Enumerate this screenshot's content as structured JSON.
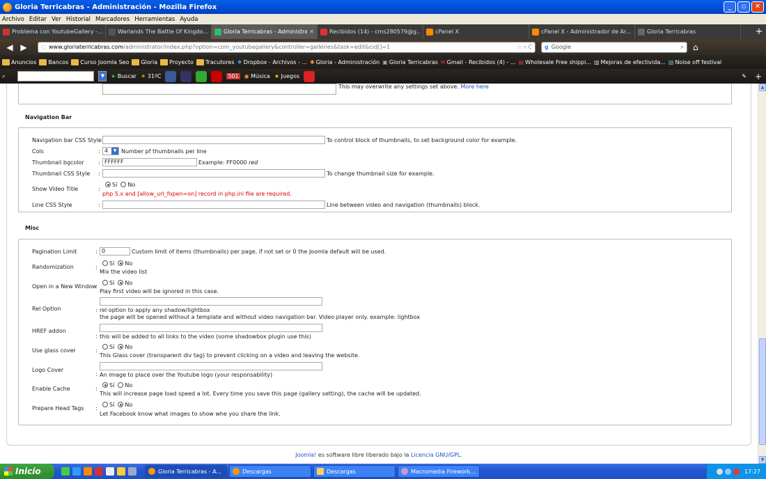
{
  "window": {
    "title": "Gloria Terricabras - Administración - Mozilla Firefox"
  },
  "menu": [
    "Archivo",
    "Editar",
    "Ver",
    "Historial",
    "Marcadores",
    "Herramientas",
    "Ayuda"
  ],
  "tabs": [
    {
      "label": "Problema con YoutubeGallery -...",
      "color": "#c33"
    },
    {
      "label": "Warlands The Battle Of Kingdo...",
      "color": "#555"
    },
    {
      "label": "Gloria Terricabras - Administrac...",
      "color": "#3b6",
      "active": true
    },
    {
      "label": "Recibidos (14) - cms280579@g...",
      "color": "#d33"
    },
    {
      "label": "cPanel X",
      "color": "#f80"
    },
    {
      "label": "cPanel X - Administrador de Ar...",
      "color": "#f80"
    },
    {
      "label": "Gloria Terricabras",
      "color": "#666"
    }
  ],
  "nav": {
    "url_domain": "www.gloriaterricabras.com",
    "url_path": "/administrator/index.php?option=com_youtubegallery&controller=galleries&task=edit&cid[]=1",
    "search_placeholder": "Google"
  },
  "bookmarks": [
    {
      "label": "Anuncios"
    },
    {
      "label": "Bancos"
    },
    {
      "label": "Curso Joomla Seo"
    },
    {
      "label": "Gloria"
    },
    {
      "label": "Proyecto"
    },
    {
      "label": "Tracutores"
    },
    {
      "label": "Dropbox - Archivos - ..."
    },
    {
      "label": "Gloria - Administración"
    },
    {
      "label": "Gloria Terricabras"
    },
    {
      "label": "Gmail - Recibidos (4) - ..."
    },
    {
      "label": "Wholesale Free shippi..."
    },
    {
      "label": "Mejoras de efectivida..."
    },
    {
      "label": "Noise off festival"
    }
  ],
  "toolbar2": {
    "buscar": "Buscar",
    "temp": "31ºC",
    "count": "501",
    "musica": "Música",
    "juegos": "Juegos"
  },
  "top_partial": {
    "note": "This may overwrite any settings set above.",
    "more": "More here"
  },
  "navigation_bar": {
    "legend": "Navigation Bar",
    "css_style": {
      "label": "Navigation bar CSS Style",
      "value": "",
      "hint": "To control block of thumbnails, to set background color for example."
    },
    "cols": {
      "label": "Cols",
      "value": "4",
      "hint": "Number pf thumbnails per line"
    },
    "bgcolor": {
      "label": "Thumbnail bgcolor",
      "value": "FFFFFF",
      "hint": "Example: FF0000",
      "hint_em": "red"
    },
    "thumb_css": {
      "label": "Thumbnail CSS Style",
      "value": "",
      "hint": "To change thumbnail size for example."
    },
    "show_title": {
      "label": "Show Video Title",
      "yes": "Sí",
      "no": "No",
      "selected": "yes",
      "warning": "php 5.x and [allow_url_fopen=on] record in php.ini file are required."
    },
    "line_css": {
      "label": "Line CSS Style",
      "value": "",
      "hint": "Line between video and navigation (thumbnails) block."
    }
  },
  "misc": {
    "legend": "Misc",
    "pagination": {
      "label": "Pagination Limit",
      "value": "0",
      "hint": "Custom limit of items (thumbnails) per page, if not set or 0 the Joomla default will be used."
    },
    "random": {
      "label": "Randomization",
      "yes": "Sí",
      "no": "No",
      "selected": "no",
      "hint": "Mix the video list"
    },
    "new_window": {
      "label": "Open in a New Window",
      "yes": "Sí",
      "no": "No",
      "selected": "no",
      "hint": "Play first video will be ignored in this case."
    },
    "rel": {
      "label": "Rel Option",
      "value": "",
      "hint1": "rel option to apply any shadow/lightbox",
      "hint2": "the page will be opened without a template and without video navigation bar. Video player only. example: lightbox"
    },
    "href": {
      "label": "HREF addon",
      "value": "",
      "hint": "this will be added to all links to the video (some shadowbox plugin use this)"
    },
    "glass": {
      "label": "Use glass cover",
      "yes": "Sí",
      "no": "No",
      "selected": "no",
      "hint": "This Glass cover (transparent div tag) to prevent clicking on a video and leaving the website."
    },
    "logo": {
      "label": "Logo Cover",
      "value": "",
      "hint": "An image to place over the Youtube logo (your responsability)"
    },
    "cache": {
      "label": "Enable Cache",
      "yes": "Sí",
      "no": "No",
      "selected": "yes",
      "hint": "This will increase page load speed a lot. Every time you save this page (gallery setting), the cache will be updated."
    },
    "head": {
      "label": "Prepare Head Tags",
      "yes": "Sí",
      "no": "No",
      "selected": "no",
      "hint": "Let Facebook know what images to show whe you share the link."
    }
  },
  "footer": {
    "joomla": "Joomla!",
    "text": "es software libre liberado bajo la",
    "license": "Licencia GNU/GPL."
  },
  "taskbar": {
    "start": "Inicio",
    "tasks": [
      {
        "label": "Gloria Terricabras - A...",
        "dark": true
      },
      {
        "label": "Descargas"
      },
      {
        "label": "Descargas"
      },
      {
        "label": "Macromedia Firework..."
      }
    ],
    "clock": "17:27"
  }
}
